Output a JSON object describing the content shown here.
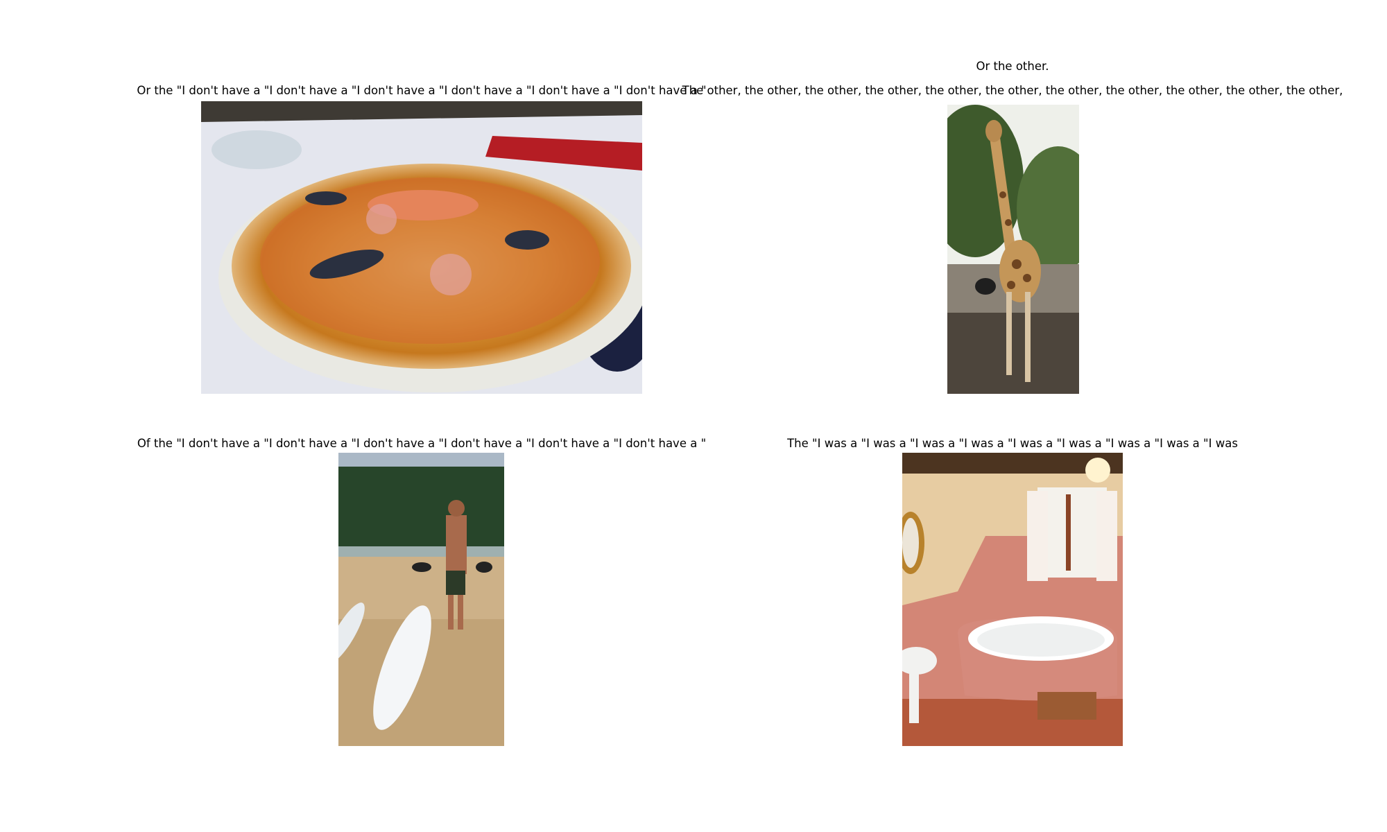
{
  "panels": [
    {
      "captions": [
        "Or the \"I don't have a \"I don't have a \"I don't have a \"I don't have a \"I don't have a \"I don't have a \""
      ],
      "subject": "pizza-photo"
    },
    {
      "captions": [
        "Or the other.",
        "The other, the other, the other, the other, the other, the other, the other, the other, the other, the other, the other,"
      ],
      "subject": "giraffe-photo"
    },
    {
      "captions": [
        "Of the \"I don't have a \"I don't have a \"I don't have a \"I don't have a \"I don't have a \"I don't have a \""
      ],
      "subject": "surfer-beach-photo"
    },
    {
      "captions": [
        "The \"I was a \"I was a \"I was a \"I was a \"I was a \"I was a \"I was a \"I was a \"I was"
      ],
      "subject": "bathroom-photo"
    }
  ]
}
